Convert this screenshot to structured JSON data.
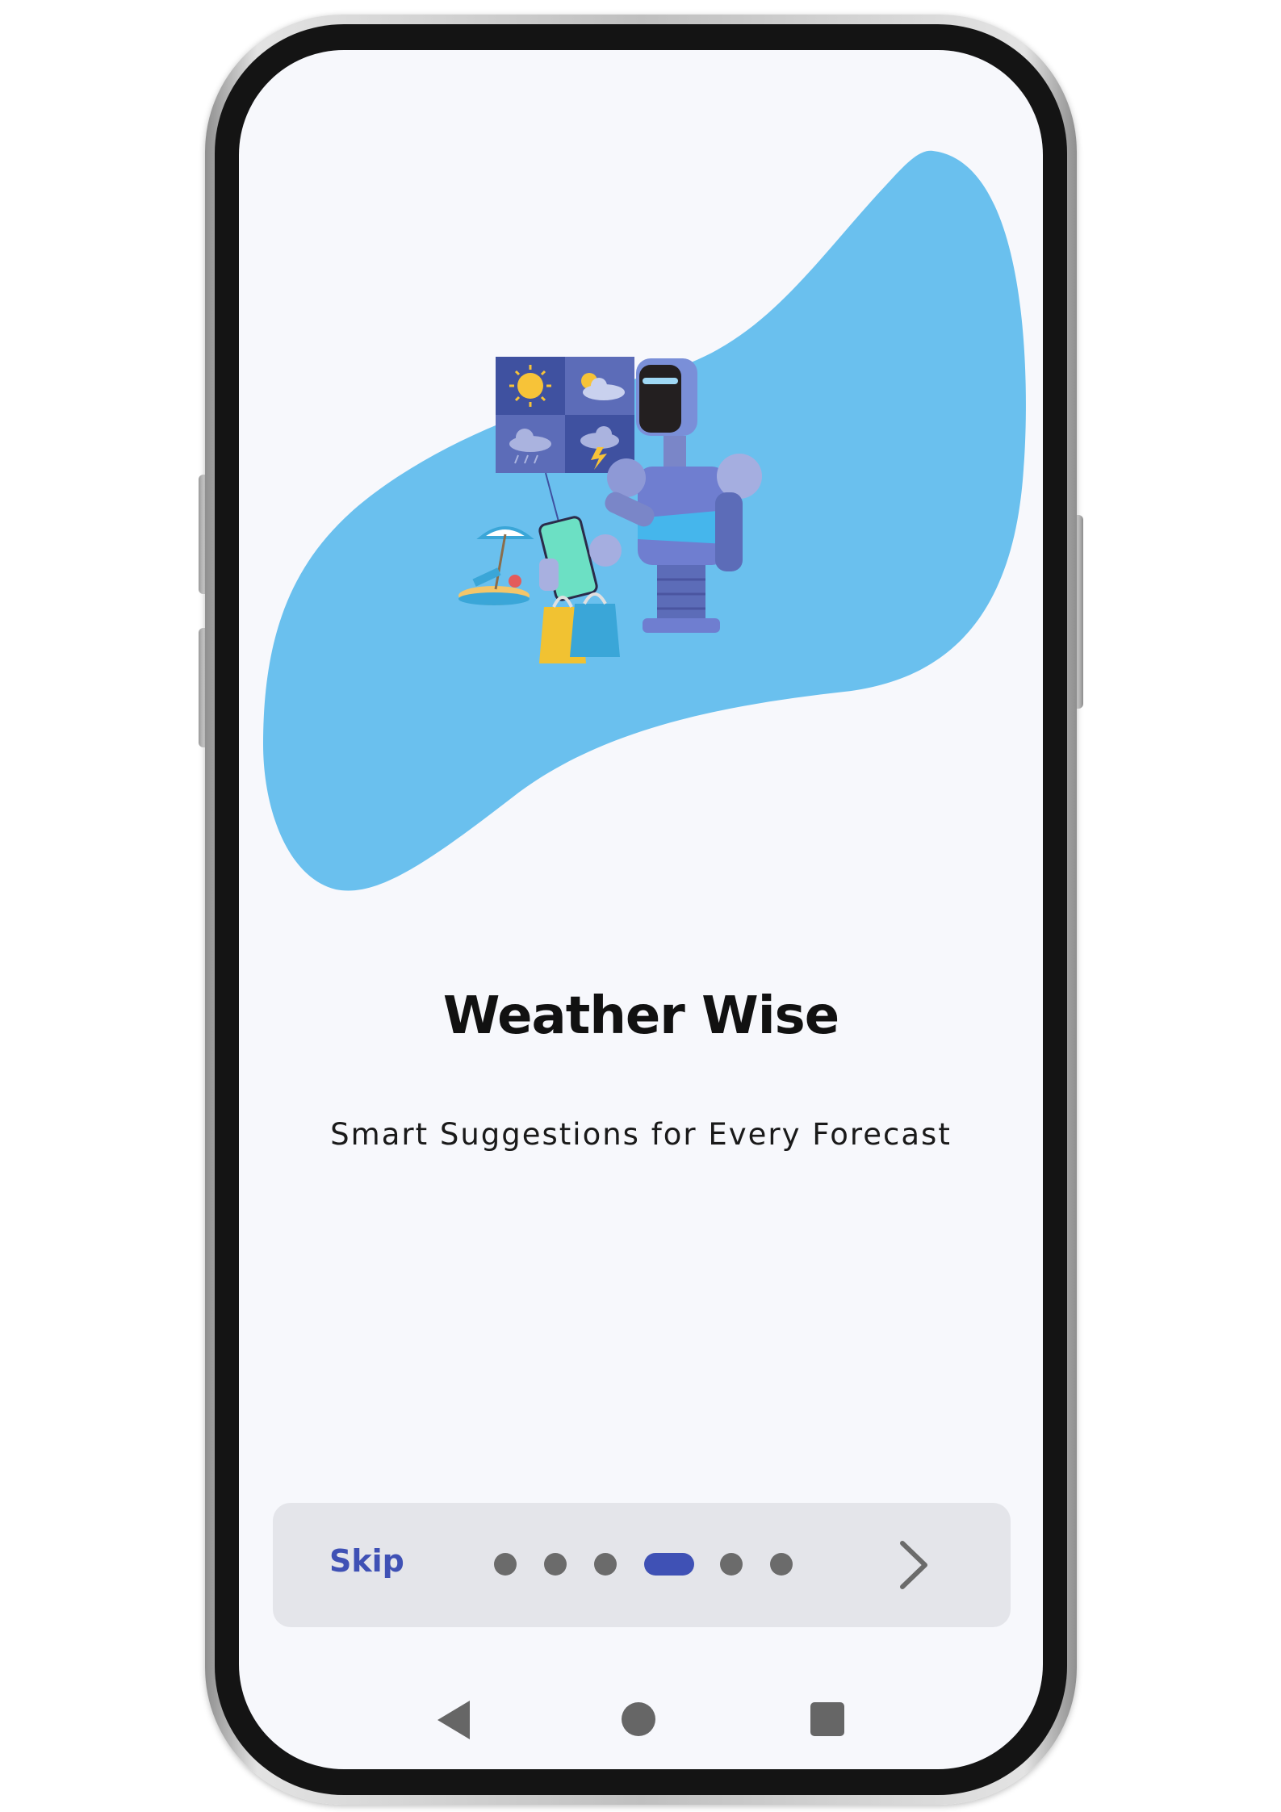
{
  "onboarding": {
    "title": "Weather Wise",
    "subtitle": "Smart Suggestions for Every Forecast",
    "skip_label": "Skip",
    "current_page": 4,
    "total_pages": 6
  },
  "colors": {
    "accent": "#3f51b5",
    "blob": "#6ac0ee",
    "background": "#f7f8fc",
    "bar": "#e4e5ea",
    "dot_inactive": "#6b6b6b"
  },
  "icons": {
    "next": "chevron-right-icon",
    "nav_back": "triangle-back-icon",
    "nav_home": "circle-home-icon",
    "nav_recents": "square-recents-icon"
  }
}
